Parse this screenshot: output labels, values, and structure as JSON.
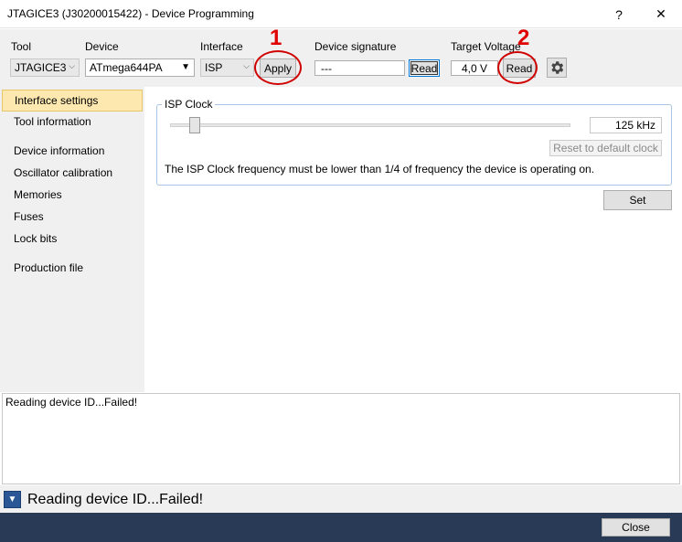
{
  "window": {
    "title": "JTAGICE3 (J30200015422) - Device Programming",
    "help_glyph": "?",
    "close_glyph": "✕"
  },
  "toolbar": {
    "tool_label": "Tool",
    "tool_value": "JTAGICE3",
    "device_label": "Device",
    "device_value": "ATmega644PA",
    "interface_label": "Interface",
    "interface_value": "ISP",
    "apply_label": "Apply",
    "signature_label": "Device signature",
    "signature_value": "---",
    "signature_read_label": "Read",
    "voltage_label": "Target Voltage",
    "voltage_value": "4,0 V",
    "voltage_read_label": "Read",
    "marker_1": "1",
    "marker_2": "2",
    "settings_icon": "gear-icon"
  },
  "sidebar": {
    "items": [
      {
        "label": "Interface settings",
        "selected": true
      },
      {
        "label": "Tool information"
      },
      {
        "label": "Device information"
      },
      {
        "label": "Oscillator calibration"
      },
      {
        "label": "Memories"
      },
      {
        "label": "Fuses"
      },
      {
        "label": "Lock bits"
      },
      {
        "label": "Production file"
      }
    ]
  },
  "interface_settings": {
    "group_title": "ISP Clock",
    "clock_value": "125 kHz",
    "reset_label": "Reset to default clock",
    "info": "The ISP Clock frequency must be lower than 1/4 of frequency the device is operating on.",
    "set_label": "Set"
  },
  "log": {
    "text": "Reading device ID...Failed!"
  },
  "status": {
    "text": "Reading device ID...Failed!"
  },
  "footer": {
    "close_label": "Close"
  },
  "colors": {
    "selected_bg": "#fde9b0",
    "footer_bg": "#283a55",
    "annotation_red": "#d00000",
    "expand_button": "#2b5797"
  }
}
